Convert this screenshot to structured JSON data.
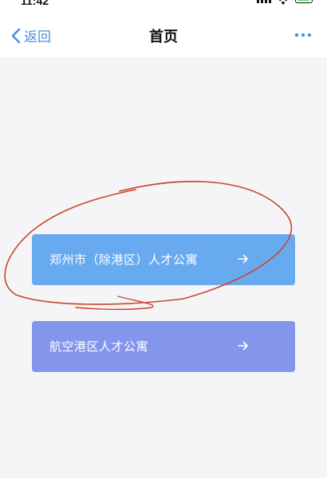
{
  "statusbar": {
    "time": "11:42"
  },
  "navbar": {
    "back_label": "返回",
    "title": "首页",
    "more_icon": "more-dots-icon"
  },
  "entries": [
    {
      "label": "郑州市（除港区）人才公寓",
      "icon": "arrow-right-icon",
      "color": "#68aaf0"
    },
    {
      "label": "航空港区人才公寓",
      "icon": "arrow-right-icon",
      "color": "#8496ec"
    }
  ],
  "annotation": {
    "color": "#c9452e"
  },
  "colors": {
    "accent": "#4a90e2",
    "background": "#f5f5f7"
  }
}
